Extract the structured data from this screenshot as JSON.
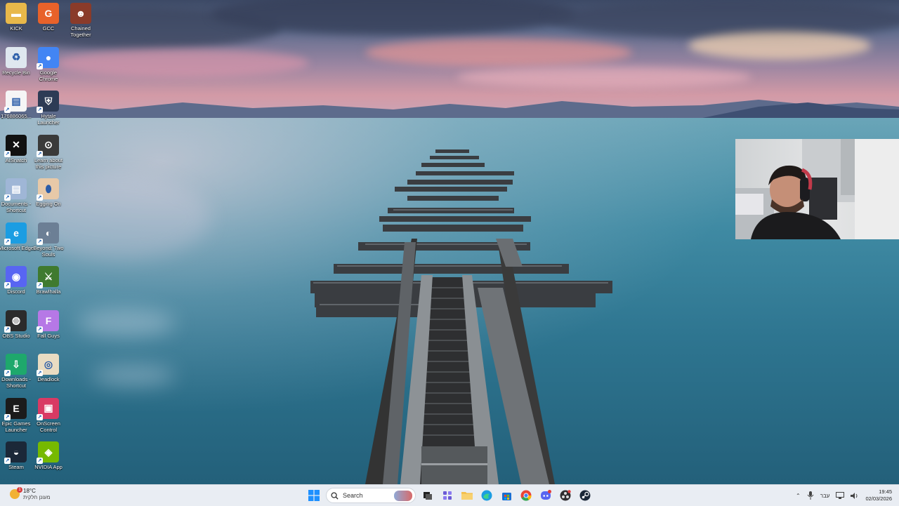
{
  "desktop": {
    "icons": [
      {
        "label": "KICK",
        "icon": "folder-icon",
        "color": "#e8b84a"
      },
      {
        "label": "GCC",
        "icon": "gcc-icon",
        "color": "#e8622a"
      },
      {
        "label": "Chained Together",
        "icon": "chained-together-icon",
        "color": "#8a3b2a"
      },
      {
        "label": "Recycle Bin",
        "icon": "recycle-bin-icon",
        "color": "#dfe7ef"
      },
      {
        "label": "Google Chrome",
        "icon": "chrome-icon",
        "color": "#4285f4"
      },
      {
        "label": "176886065...",
        "icon": "document-icon",
        "color": "#f5f5f5"
      },
      {
        "label": "Hytale Launcher",
        "icon": "hytale-icon",
        "color": "#2d3b55"
      },
      {
        "label": "AISnatch",
        "icon": "aisnatch-icon",
        "color": "#111111"
      },
      {
        "label": "Learn about this picture",
        "icon": "learn-picture-icon",
        "color": "#3a3a3a"
      },
      {
        "label": "Documents - Shortcut",
        "icon": "documents-shortcut-icon",
        "color": "#9fb6d6"
      },
      {
        "label": "Egging On",
        "icon": "egging-on-icon",
        "color": "#e7c9a8"
      },
      {
        "label": "Microsoft Edge",
        "icon": "edge-icon",
        "color": "#1b9de2"
      },
      {
        "label": "Beyond: Two Souls",
        "icon": "beyond-two-souls-icon",
        "color": "#6c7f95"
      },
      {
        "label": "Discord",
        "icon": "discord-icon",
        "color": "#5865f2"
      },
      {
        "label": "Brawlhalla",
        "icon": "brawlhalla-icon",
        "color": "#3f7a2f"
      },
      {
        "label": "OBS Studio",
        "icon": "obs-icon",
        "color": "#2b2b2b"
      },
      {
        "label": "Fall Guys",
        "icon": "fall-guys-icon",
        "color": "#b678e6"
      },
      {
        "label": "Downloads - Shortcut",
        "icon": "downloads-shortcut-icon",
        "color": "#1ea86c"
      },
      {
        "label": "Deadlock",
        "icon": "deadlock-icon",
        "color": "#e9dcc2"
      },
      {
        "label": "Epic Games Launcher",
        "icon": "epic-games-icon",
        "color": "#1b1b1b"
      },
      {
        "label": "OnScreen Control",
        "icon": "onscreen-control-icon",
        "color": "#d93a64"
      },
      {
        "label": "Steam",
        "icon": "steam-icon",
        "color": "#1b2838"
      },
      {
        "label": "NVIDIA App",
        "icon": "nvidia-icon",
        "color": "#76b900"
      }
    ]
  },
  "taskbar": {
    "weather": {
      "temp": "18°C",
      "desc": "מעונן חלקית",
      "badge": "1"
    },
    "search_placeholder": "Search",
    "apps": [
      {
        "name": "start-button",
        "icon": "windows-icon"
      },
      {
        "name": "task-view-button",
        "icon": "task-view-icon"
      },
      {
        "name": "taskbar-app-1",
        "icon": "puzzle-icon"
      },
      {
        "name": "file-explorer-button",
        "icon": "folder-icon"
      },
      {
        "name": "edge-taskbar-button",
        "icon": "edge-icon"
      },
      {
        "name": "store-taskbar-button",
        "icon": "store-icon"
      },
      {
        "name": "chrome-taskbar-button",
        "icon": "chrome-icon"
      },
      {
        "name": "discord-taskbar-button",
        "icon": "discord-icon"
      },
      {
        "name": "obs-taskbar-button",
        "icon": "obs-icon"
      },
      {
        "name": "steam-taskbar-button",
        "icon": "steam-icon"
      }
    ],
    "tray": {
      "language": "עבר",
      "time": "19:45",
      "date": "02/03/2026"
    }
  },
  "colors": {
    "taskbar_bg": "#e9edf3",
    "accent": "#0078d4"
  }
}
